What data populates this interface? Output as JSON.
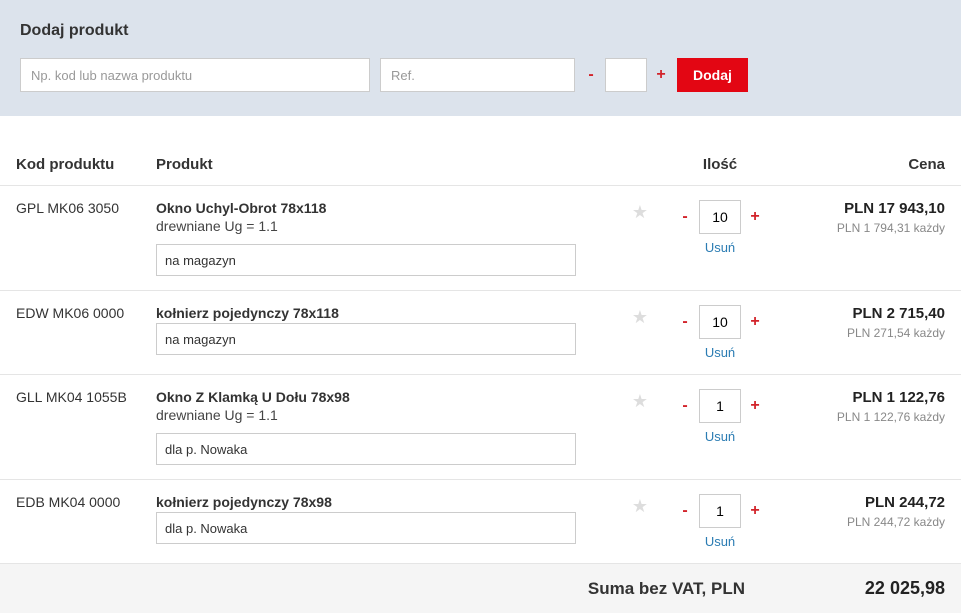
{
  "addPanel": {
    "title": "Dodaj produkt",
    "searchPlaceholder": "Np. kod lub nazwa produktu",
    "refPlaceholder": "Ref.",
    "addBtn": "Dodaj"
  },
  "headers": {
    "code": "Kod produktu",
    "product": "Produkt",
    "qty": "Ilość",
    "price": "Cena"
  },
  "rows": [
    {
      "code": "GPL MK06 3050",
      "name": "Okno Uchyl-Obrot 78x118",
      "desc": "drewniane Ug = 1.1",
      "note": "na magazyn",
      "qty": "10",
      "priceMain": "PLN 17 943,10",
      "priceEach": "PLN 1 794,31 każdy"
    },
    {
      "code": "EDW MK06 0000",
      "name": "kołnierz pojedynczy 78x118",
      "desc": "",
      "note": "na magazyn",
      "qty": "10",
      "priceMain": "PLN 2 715,40",
      "priceEach": "PLN 271,54 każdy"
    },
    {
      "code": "GLL MK04 1055B",
      "name": "Okno Z Klamką U Dołu 78x98",
      "desc": "drewniane Ug = 1.1",
      "note": "dla p. Nowaka",
      "qty": "1",
      "priceMain": "PLN 1 122,76",
      "priceEach": "PLN 1 122,76 każdy"
    },
    {
      "code": "EDB MK04 0000",
      "name": "kołnierz pojedynczy 78x98",
      "desc": "",
      "note": "dla p. Nowaka",
      "qty": "1",
      "priceMain": "PLN 244,72",
      "priceEach": "PLN 244,72 każdy"
    }
  ],
  "removeLabel": "Usuń",
  "footer": {
    "label": "Suma bez VAT, PLN",
    "total": "22 025,98"
  },
  "icons": {
    "star": "★",
    "minus": "-",
    "plus": "+"
  }
}
